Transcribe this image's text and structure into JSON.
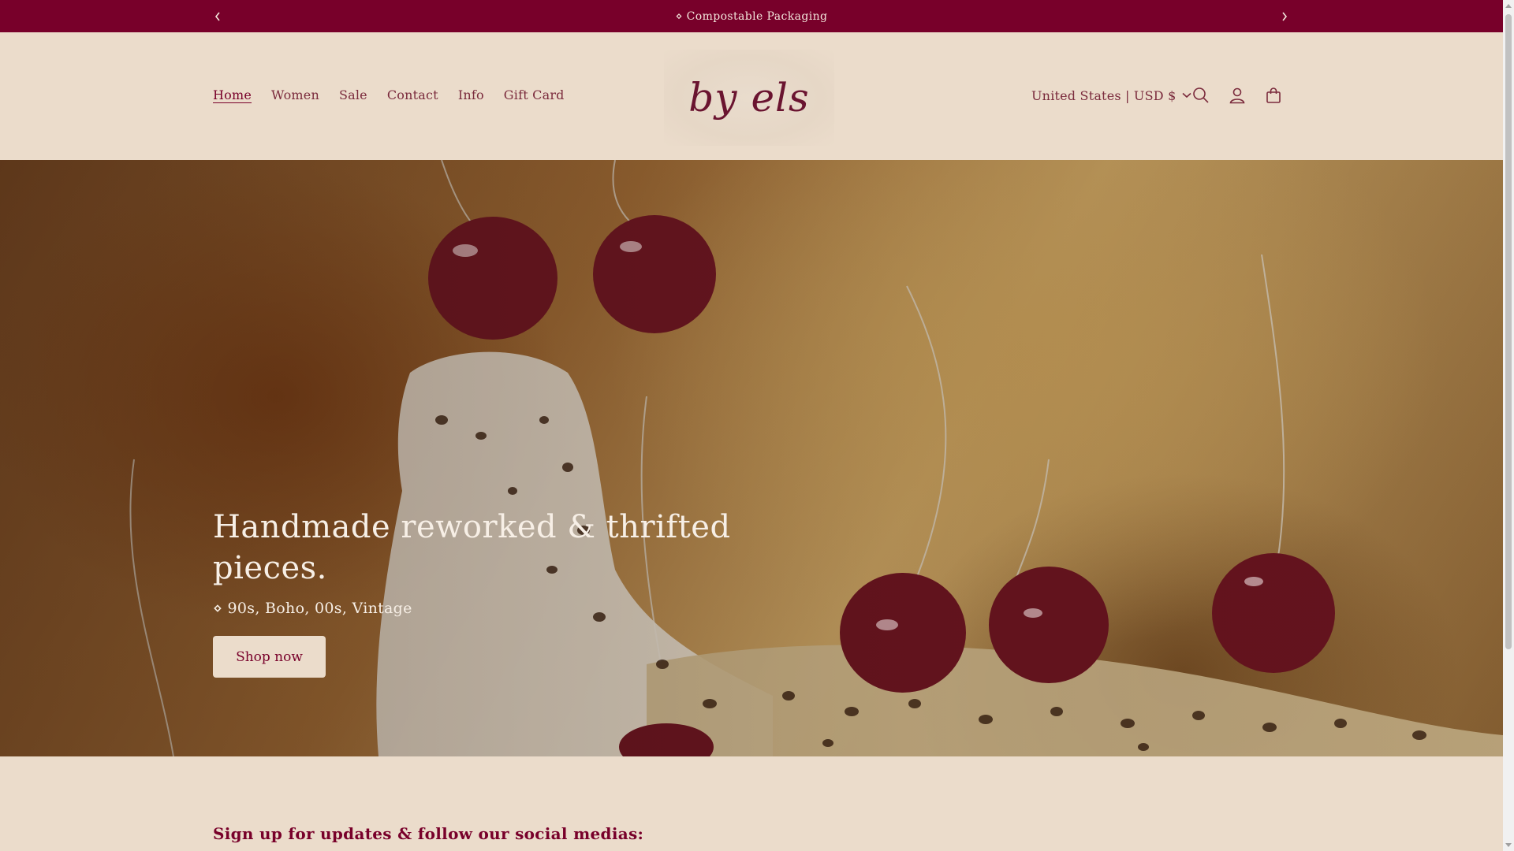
{
  "announcement": {
    "text": "⋄ Compostable Packaging"
  },
  "nav": {
    "items": [
      {
        "label": "Home",
        "active": true
      },
      {
        "label": "Women"
      },
      {
        "label": "Sale"
      },
      {
        "label": "Contact"
      },
      {
        "label": "Info"
      },
      {
        "label": "Gift Card"
      }
    ]
  },
  "logo": {
    "text": "by els"
  },
  "header": {
    "currency": "United States | USD $",
    "icons": [
      "search-icon",
      "account-icon",
      "cart-icon"
    ]
  },
  "hero": {
    "title": "Handmade reworked & thrifted pieces.",
    "subtitle": "⋄ 90s, Boho, 00s, Vintage",
    "button": "Shop now"
  },
  "newsletter": {
    "heading": "Sign up for updates & follow our social medias:"
  },
  "colors": {
    "announcement_bg": "#78002a",
    "page_bg": "#ebdccb",
    "accent": "#78002a"
  }
}
